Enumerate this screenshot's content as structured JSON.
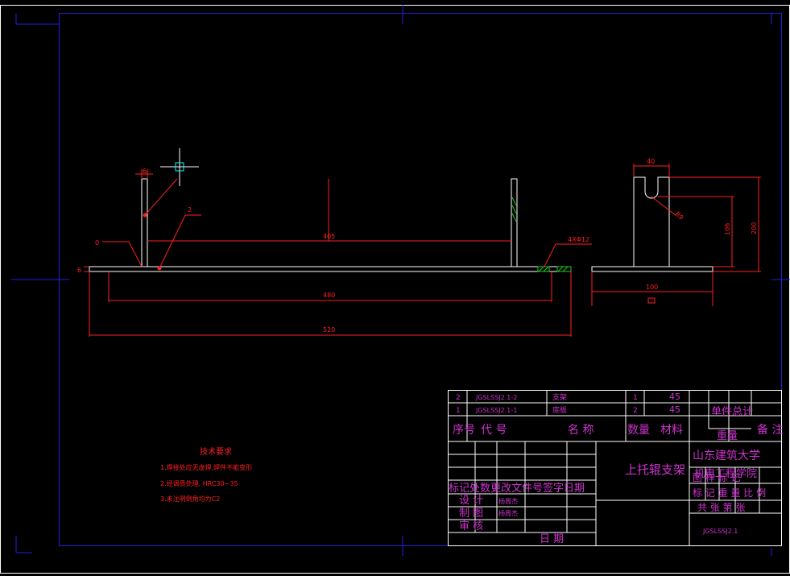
{
  "colors": {
    "background": "#000000",
    "frame": "#0000cc",
    "outline": "#ffffff",
    "dimension": "#ff2020",
    "text_magenta": "#cc33cc",
    "hatch": "#22cc22",
    "cursor": "#00ffff"
  },
  "dimensions": {
    "d405": "405",
    "d480": "480",
    "d520": "520",
    "d40": "40",
    "d100": "100",
    "d106": "106",
    "d200": "200",
    "d6_top": "6",
    "d6_left": "6",
    "d0": "0",
    "hole": "4XΦ12",
    "radius": "R9",
    "leader_1": "1",
    "leader_2": "2"
  },
  "tech_requirements": {
    "title": "技术要求",
    "items": [
      "1.焊接处应无虚焊,焊件不能变形",
      "2.经调质处理, HRC30~35",
      "3.未注明倒角均为C2"
    ]
  },
  "bom": {
    "rows": [
      {
        "no": "2",
        "code": "JGSLSSJ2.1-2",
        "name": "支架",
        "qty": "1",
        "material": "45"
      },
      {
        "no": "1",
        "code": "JGSLSSJ2.1-1",
        "name": "底板",
        "qty": "2",
        "material": "45"
      }
    ],
    "header": {
      "no": "序号",
      "code": "代 号",
      "name": "名 称",
      "qty": "数量",
      "material": "材料",
      "weight_single": "单件",
      "weight_total": "总计",
      "weight": "重量",
      "note": "备 注"
    }
  },
  "title_block": {
    "part_name": "上托辊支架",
    "school": "山东建筑大学",
    "college": "机电工程学院",
    "revision_header": "标记处数更改文件号签字日期",
    "design": "设 计",
    "drafting": "制 图",
    "review": "审 核",
    "designer": "杨周杰",
    "drafter": "杨周杰",
    "date": "日 期",
    "stage_mark": "图 样 标 记",
    "weight": "重 量",
    "scale": "比 例",
    "stage_row": "标 记 重 量 比 例",
    "sheets": "共 张 第 张",
    "drawing_number": "JGSLSSJ2.1"
  }
}
